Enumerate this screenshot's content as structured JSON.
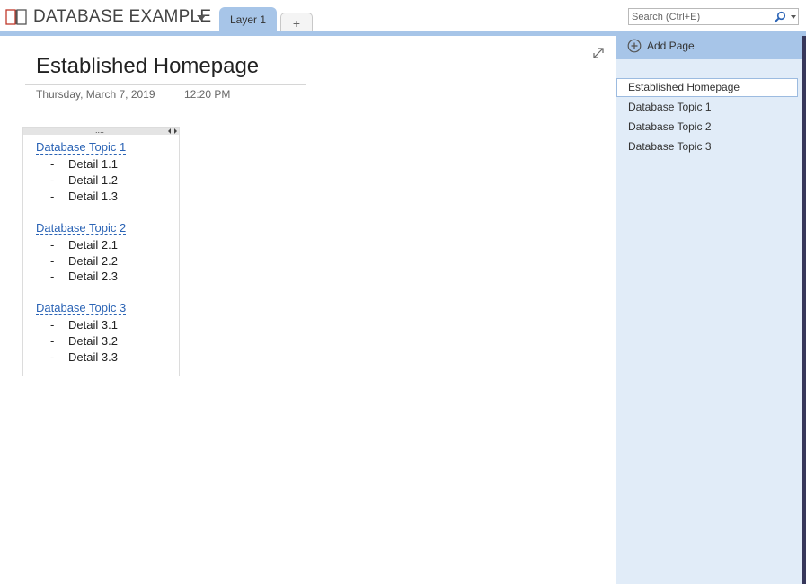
{
  "header": {
    "notebook_title": "DATABASE EXAMPLE",
    "tabs": [
      {
        "label": "Layer 1"
      }
    ],
    "add_tab_label": "+",
    "search_placeholder": "Search (Ctrl+E)"
  },
  "page": {
    "title": "Established Homepage",
    "date": "Thursday, March 7, 2019",
    "time": "12:20 PM",
    "outline": {
      "handle_dots": "....",
      "topics": [
        {
          "title": "Database Topic 1",
          "details": [
            {
              "dash": "-",
              "text": "Detail 1.1"
            },
            {
              "dash": "-",
              "text": "Detail 1.2"
            },
            {
              "dash": "-",
              "text": "Detail 1.3"
            }
          ]
        },
        {
          "title": "Database Topic 2",
          "details": [
            {
              "dash": "-",
              "text": "Detail 2.1"
            },
            {
              "dash": "-",
              "text": "Detail 2.2"
            },
            {
              "dash": "-",
              "text": "Detail 2.3"
            }
          ]
        },
        {
          "title": "Database Topic 3",
          "details": [
            {
              "dash": "-",
              "text": "Detail 3.1"
            },
            {
              "dash": "-",
              "text": "Detail 3.2"
            },
            {
              "dash": "-",
              "text": "Detail 3.3"
            }
          ]
        }
      ]
    }
  },
  "pages_pane": {
    "add_page_label": "Add Page",
    "items": [
      {
        "label": "Established Homepage",
        "selected": true
      },
      {
        "label": "Database Topic 1",
        "selected": false
      },
      {
        "label": "Database Topic 2",
        "selected": false
      },
      {
        "label": "Database Topic 3",
        "selected": false
      }
    ]
  },
  "icons": {
    "notebook": "notebook-icon",
    "search": "search-icon",
    "expand": "expand-icon",
    "add_page": "add-page-icon"
  },
  "colors": {
    "accent": "#a7c5e8",
    "pane_background": "#e1ecf8",
    "link": "#2a63b5"
  }
}
